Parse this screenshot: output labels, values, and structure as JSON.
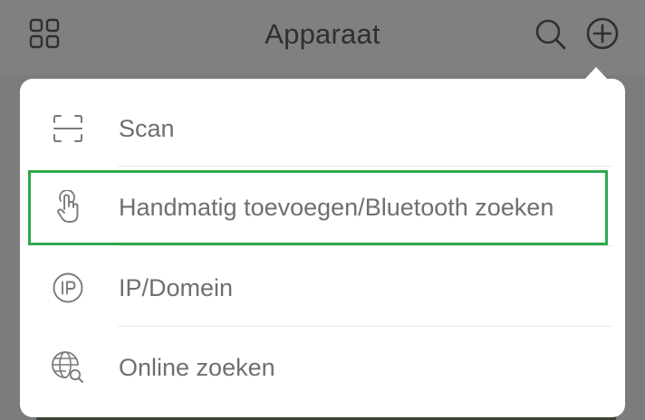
{
  "header": {
    "title": "Apparaat",
    "left_icon": "grid-icon",
    "right_icons": [
      "search-icon",
      "add-circle-icon"
    ]
  },
  "menu": {
    "items": [
      {
        "label": "Scan",
        "icon": "scan-icon"
      },
      {
        "label": "Handmatig toevoegen/Bluetooth zoeken",
        "icon": "hand-pointer-icon",
        "highlighted": true
      },
      {
        "label": "IP/Domein",
        "icon": "ip-icon"
      },
      {
        "label": "Online zoeken",
        "icon": "globe-search-icon"
      }
    ]
  },
  "colors": {
    "overlay": "#7a7a7a",
    "menu_background": "#ffffff",
    "text": "#6f6f6f",
    "title": "#2f2f2f",
    "highlight": "#2ea84f"
  }
}
